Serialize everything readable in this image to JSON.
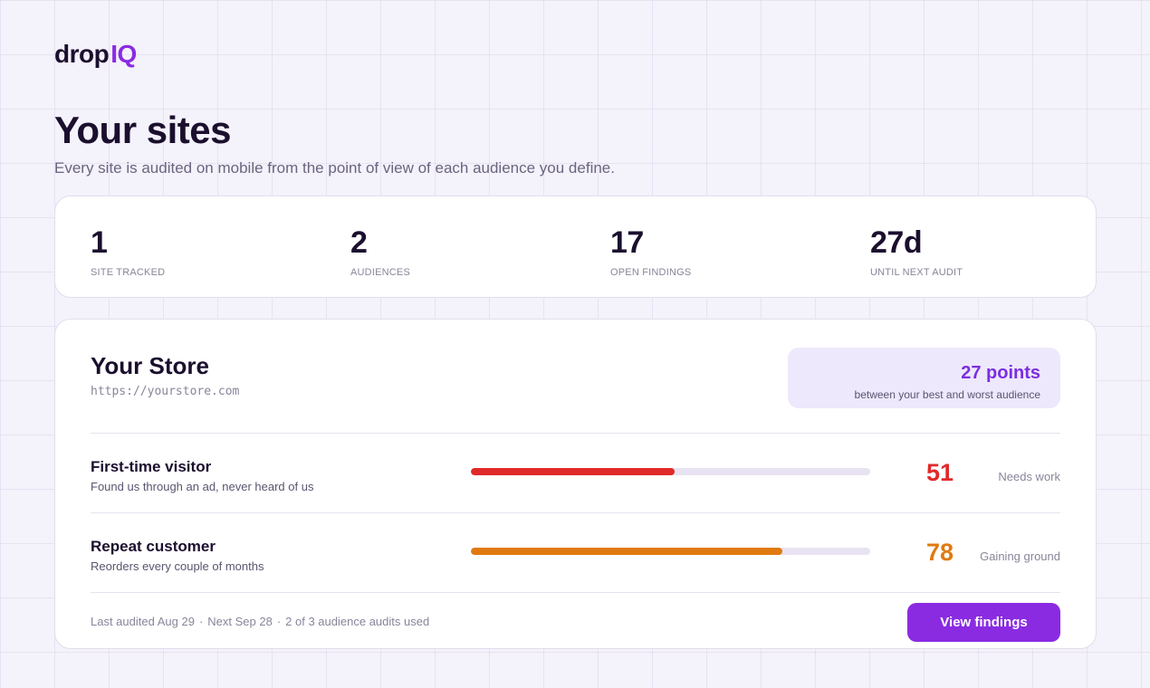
{
  "brand": {
    "part1": "drop",
    "part2": "IQ",
    "accent": "#8a2be2"
  },
  "header": {
    "title": "Your sites",
    "subtitle": "Every site is audited on mobile from the point of view of each audience you define."
  },
  "stats": [
    {
      "value": "1",
      "label": "SITE TRACKED"
    },
    {
      "value": "2",
      "label": "AUDIENCES"
    },
    {
      "value": "17",
      "label": "OPEN FINDINGS"
    },
    {
      "value": "27d",
      "label": "UNTIL NEXT AUDIT"
    }
  ],
  "site": {
    "name": "Your Store",
    "url": "https://yourstore.com",
    "gap": {
      "value": "27 points",
      "caption": "between your best and worst audience"
    },
    "audiences": [
      {
        "name": "First-time visitor",
        "description": "Found us through an ad, never heard of us",
        "score": "51",
        "progress": 0.51,
        "status": "Needs work",
        "color": "#e02a2a"
      },
      {
        "name": "Repeat customer",
        "description": "Reorders every couple of months",
        "score": "78",
        "progress": 0.78,
        "status": "Gaining ground",
        "color": "#e07a10"
      }
    ],
    "footer": {
      "last_audited": "Last audited Aug 29",
      "next": "Next Sep 28",
      "usage": "2 of 3 audience audits used",
      "separator": "·"
    },
    "cta_label": "View findings"
  }
}
